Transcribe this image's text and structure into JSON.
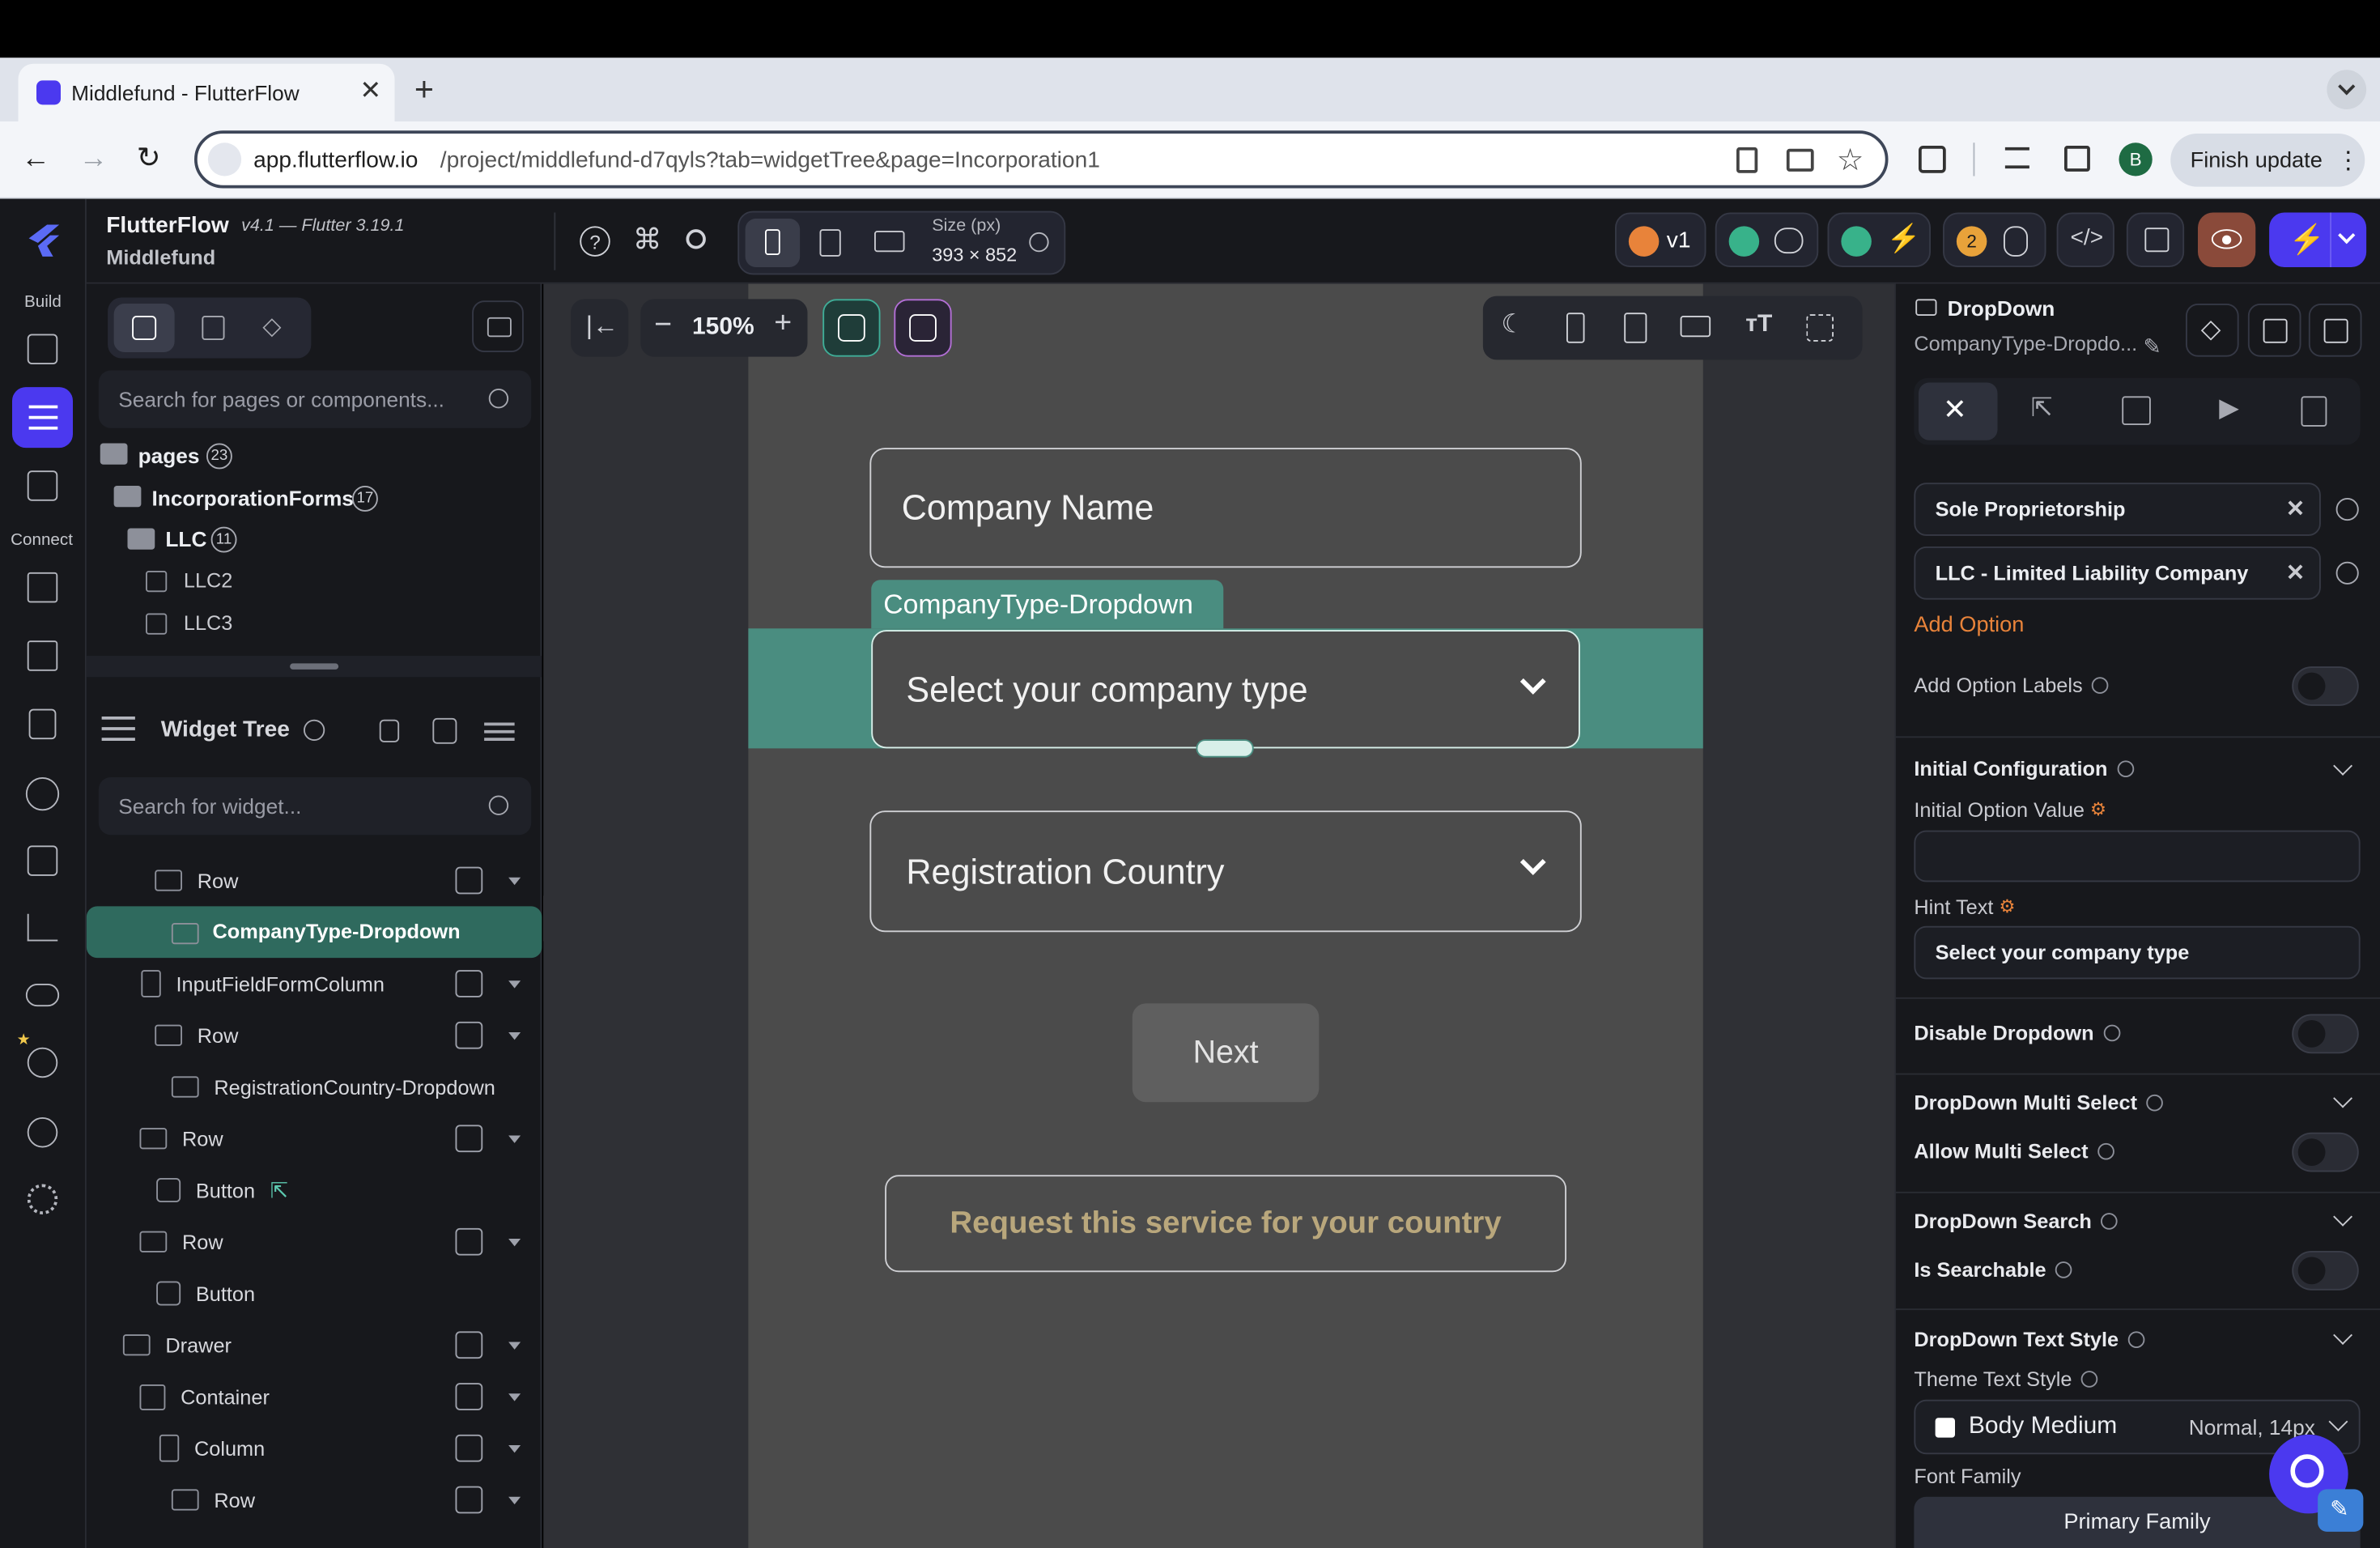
{
  "browser": {
    "tab_title": "Middlefund - FlutterFlow",
    "url_host": "app.flutterflow.io",
    "url_path": "/project/middlefund-d7qyls?tab=widgetTree&page=Incorporation1",
    "finish_update": "Finish update",
    "profile_initial": "B"
  },
  "header": {
    "app_name": "FlutterFlow",
    "version": "v4.1 — Flutter 3.19.1",
    "project": "Middlefund",
    "size_label": "Size (px)",
    "size_value": "393 × 852",
    "version_badge": "v1",
    "issues_count": "2"
  },
  "rail": {
    "build": "Build",
    "connect": "Connect"
  },
  "left": {
    "search_pages": "Search for pages or components...",
    "pages": "pages",
    "pages_count": "23",
    "folder1": "IncorporationForms",
    "folder1_count": "17",
    "folder2": "LLC",
    "folder2_count": "11",
    "page1": "LLC2",
    "page2": "LLC3",
    "widget_tree": "Widget Tree",
    "search_widgets": "Search for widget...",
    "tree": [
      "Row",
      "CompanyType-Dropdown",
      "InputFieldFormColumn",
      "Row",
      "RegistrationCountry-Dropdown",
      "Row",
      "Button",
      "Row",
      "Button",
      "Drawer",
      "Container",
      "Column",
      "Row"
    ]
  },
  "canvas": {
    "zoom": "150%",
    "company_name": "Company Name",
    "selected_tag": "CompanyType-Dropdown",
    "company_type_hint": "Select your company type",
    "registration_country": "Registration Country",
    "next": "Next",
    "request_service": "Request this service for your country"
  },
  "right": {
    "widget_type": "DropDown",
    "widget_name": "CompanyType-Dropdo...",
    "option1": "Sole Proprietorship",
    "option2": "LLC - Limited Liability Company",
    "add_option": "Add Option",
    "add_option_labels": "Add Option Labels",
    "initial_config": "Initial Configuration",
    "initial_option_value": "Initial Option Value",
    "hint_text_label": "Hint Text",
    "hint_text_value": "Select your company type",
    "disable_dropdown": "Disable Dropdown",
    "multi_select": "DropDown Multi Select",
    "allow_multi": "Allow Multi Select",
    "dd_search": "DropDown Search",
    "is_searchable": "Is Searchable",
    "text_style": "DropDown Text Style",
    "theme_text_style": "Theme Text Style",
    "body_medium": "Body Medium",
    "normal_14": "Normal, 14px",
    "font_family": "Font Family",
    "primary_family": "Primary Family"
  },
  "colors": {
    "accent_purple": "#4b39ef",
    "selection_teal": "#4a8d80",
    "orange": "#e8833a",
    "request_text": "#b9a77c"
  }
}
